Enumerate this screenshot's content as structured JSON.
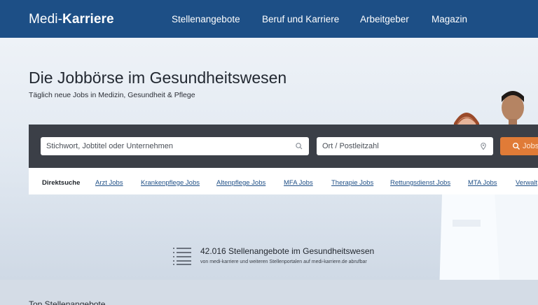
{
  "header": {
    "logo_light": "Medi-",
    "logo_bold": "Karriere",
    "nav": [
      "Stellenangebote",
      "Beruf und Karriere",
      "Arbeitgeber",
      "Magazin"
    ]
  },
  "hero": {
    "title": "Die Jobbörse im Gesundheitswesen",
    "subtitle": "Täglich neue Jobs in Medizin, Gesundheit & Pflege"
  },
  "search": {
    "keyword_placeholder": "Stichwort, Jobtitel oder Unternehmen",
    "location_placeholder": "Ort / Postleitzahl",
    "button_label": "Jobs"
  },
  "direct_search": {
    "label": "Direktsuche",
    "links": [
      "Arzt Jobs",
      "Krankenpflege Jobs",
      "Altenpflege Jobs",
      "MFA Jobs",
      "Therapie Jobs",
      "Rettungsdienst Jobs",
      "MTA Jobs",
      "Verwalt"
    ]
  },
  "stats": {
    "main": "42.016 Stellenangebote im Gesundheitswesen",
    "sub": "von medi-karriere und weiteren Stellenportalen auf medi-karriere.de abrufbar"
  },
  "section": {
    "top_heading": "Top Stellenangebote"
  },
  "colors": {
    "header_bg": "#1d4f86",
    "search_bg": "#3b3f47",
    "button_bg": "#e07b37",
    "link": "#1f4f86"
  },
  "icons": {
    "search": "search-icon",
    "location": "location-pin-icon",
    "list": "list-icon"
  }
}
